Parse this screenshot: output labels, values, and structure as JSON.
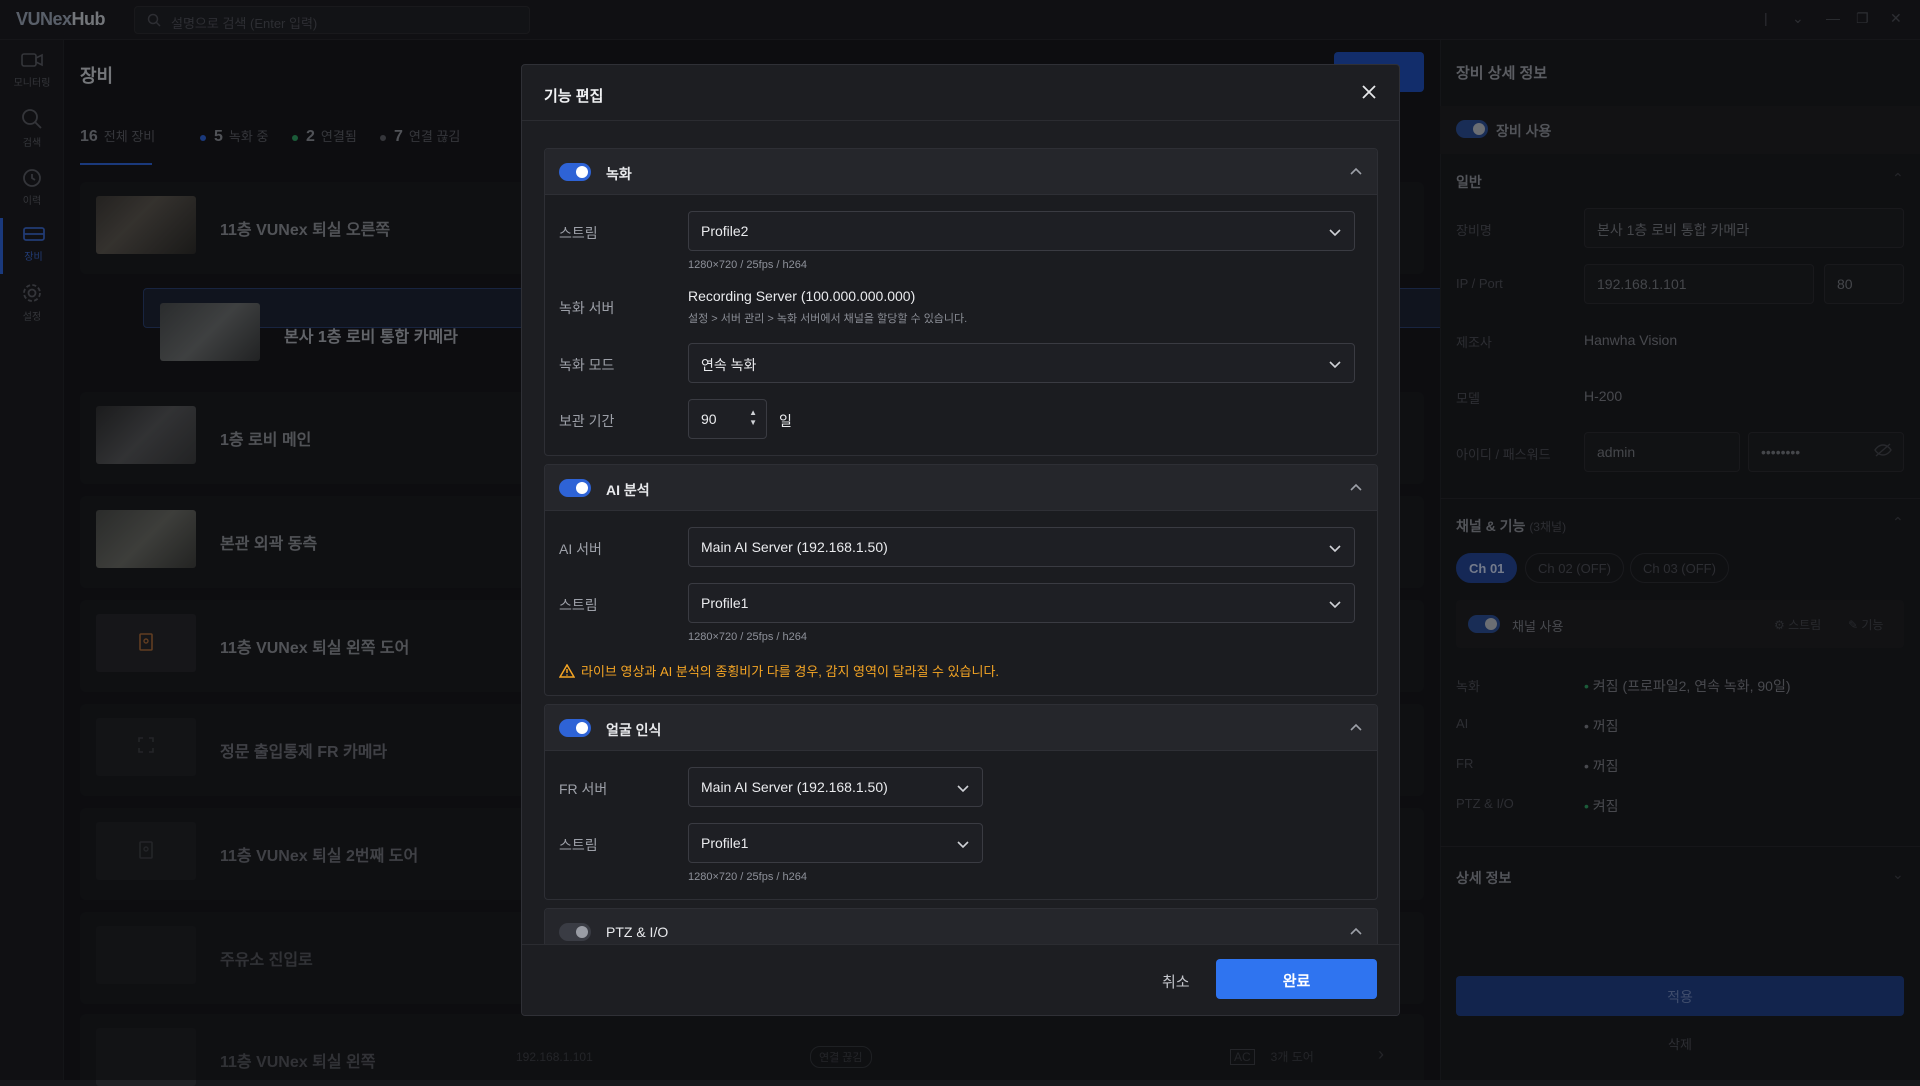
{
  "app": {
    "logo_a": "VUNex",
    "logo_b": "Hub",
    "search_placeholder": "설명으로 검색 (Enter 입력)"
  },
  "sidebar": {
    "items": [
      {
        "label": "모니터링",
        "icon": "camera-icon"
      },
      {
        "label": "검색",
        "icon": "search-icon"
      },
      {
        "label": "이력",
        "icon": "history-icon"
      },
      {
        "label": "장비",
        "icon": "device-icon"
      },
      {
        "label": "설정",
        "icon": "gear-icon"
      }
    ]
  },
  "main": {
    "title": "장비",
    "stats": [
      {
        "count": "16",
        "label": "전체 장비",
        "color": ""
      },
      {
        "count": "5",
        "label": "녹화 중",
        "color": "#2e63d6"
      },
      {
        "count": "2",
        "label": "연결됨",
        "color": "#2f9e63"
      },
      {
        "count": "7",
        "label": "연결 끊김",
        "color": "#5c5e66"
      }
    ],
    "devices": [
      {
        "name": "11층 VUNex 퇴실 오른쪽"
      },
      {
        "name": "본사 1층 로비 통합 카메라"
      },
      {
        "name": "1층 로비 메인"
      },
      {
        "name": "본관 외곽 동측"
      },
      {
        "name": "11층 VUNex 퇴실 왼쪽 도어"
      },
      {
        "name": "정문 출입통제 FR 카메라"
      },
      {
        "name": "11층 VUNex 퇴실 2번째 도어"
      },
      {
        "name": "주유소 진입로"
      },
      {
        "name": "11층 VUNex 퇴실 왼쪽",
        "ip": "192.168.1.101",
        "chip": "연결 끊김",
        "badge": "AC",
        "door": "3개 도어"
      }
    ]
  },
  "detail": {
    "title": "장비 상세 정보",
    "use_label": "장비 사용",
    "general_title": "일반",
    "name_label": "장비명",
    "name_value": "본사 1층 로비 통합 카메라",
    "ipport_label": "IP / Port",
    "ip_value": "192.168.1.101",
    "port_value": "80",
    "maker_label": "제조사",
    "maker_value": "Hanwha Vision",
    "model_label": "모델",
    "model_value": "H-200",
    "cred_label": "아이디 / 패스워드",
    "id_value": "admin",
    "pw_value": "••••••••",
    "channel_title": "채널 & 기능",
    "channel_count": "(3채널)",
    "channel_tabs": [
      "Ch 01",
      "Ch 02 (OFF)",
      "Ch 03 (OFF)"
    ],
    "channel_use_label": "채널 사용",
    "stream_link": "스트림",
    "func_link": "기능",
    "features": [
      {
        "label": "녹화",
        "value": "켜짐 (프로파일2, 연속 녹화, 90일)"
      },
      {
        "label": "AI",
        "value": "꺼짐"
      },
      {
        "label": "FR",
        "value": "꺼짐"
      },
      {
        "label": "PTZ & I/O",
        "value": "켜짐"
      }
    ],
    "more_title": "상세 정보",
    "apply_label": "적용",
    "delete_label": "삭제"
  },
  "modal": {
    "title": "기능 편집",
    "recording": {
      "title": "녹화",
      "stream_label": "스트림",
      "stream_value": "Profile2",
      "stream_hint": "1280×720 / 25fps / h264",
      "server_label": "녹화 서버",
      "server_value": "Recording Server (100.000.000.000)",
      "server_hint": "설정 > 서버 관리 > 녹화 서버에서 채널을 할당할 수 있습니다.",
      "mode_label": "녹화 모드",
      "mode_value": "연속 녹화",
      "retention_label": "보관 기간",
      "retention_value": "90",
      "retention_unit": "일"
    },
    "ai": {
      "title": "AI 분석",
      "server_label": "AI 서버",
      "server_value": "Main AI Server (192.168.1.50)",
      "stream_label": "스트림",
      "stream_value": "Profile1",
      "stream_hint": "1280×720 / 25fps / h264",
      "warning": "라이브 영상과 AI 분석의 종횡비가 다를 경우, 감지 영역이 달라질 수 있습니다."
    },
    "face": {
      "title": "얼굴 인식",
      "server_label": "FR 서버",
      "server_value": "Main AI Server (192.168.1.50)",
      "stream_label": "스트림",
      "stream_value": "Profile1",
      "stream_hint": "1280×720 / 25fps / h264"
    },
    "ptz": {
      "title": "PTZ & I/O"
    },
    "cancel_label": "취소",
    "done_label": "완료"
  },
  "colors": {
    "accent": "#2f74f0",
    "warning": "#f5a524"
  }
}
